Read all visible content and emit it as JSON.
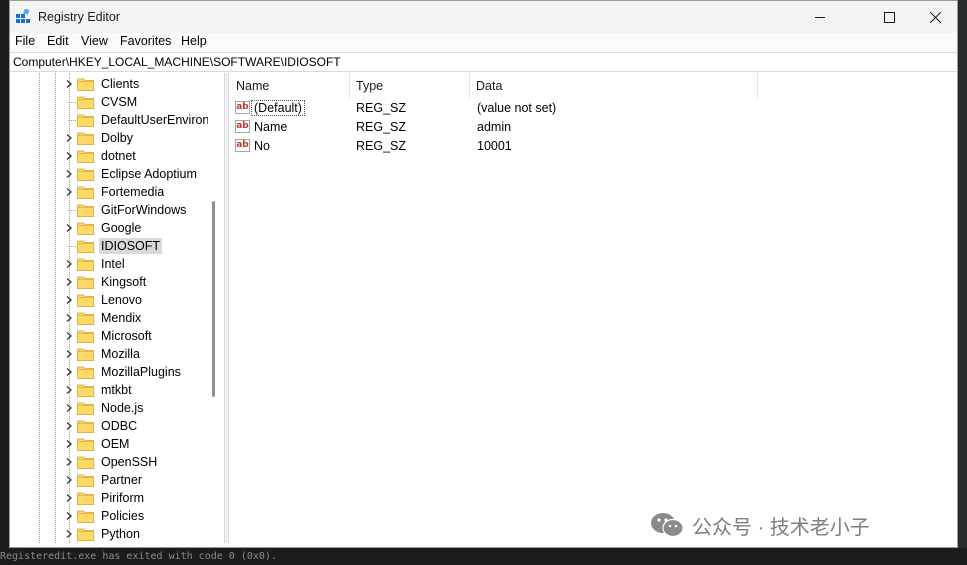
{
  "window": {
    "title": "Registry Editor"
  },
  "menu": [
    {
      "label": "File"
    },
    {
      "label": "Edit"
    },
    {
      "label": "View"
    },
    {
      "label": "Favorites"
    },
    {
      "label": "Help"
    }
  ],
  "address": "Computer\\HKEY_LOCAL_MACHINE\\SOFTWARE\\IDIOSOFT",
  "tree": {
    "items": [
      {
        "label": "Clients",
        "expandable": true
      },
      {
        "label": "CVSM",
        "expandable": false
      },
      {
        "label": "DefaultUserEnvironn",
        "expandable": false
      },
      {
        "label": "Dolby",
        "expandable": true
      },
      {
        "label": "dotnet",
        "expandable": true
      },
      {
        "label": "Eclipse Adoptium",
        "expandable": true
      },
      {
        "label": "Fortemedia",
        "expandable": true
      },
      {
        "label": "GitForWindows",
        "expandable": false
      },
      {
        "label": "Google",
        "expandable": true
      },
      {
        "label": "IDIOSOFT",
        "expandable": false,
        "selected": true
      },
      {
        "label": "Intel",
        "expandable": true
      },
      {
        "label": "Kingsoft",
        "expandable": true
      },
      {
        "label": "Lenovo",
        "expandable": true
      },
      {
        "label": "Mendix",
        "expandable": true
      },
      {
        "label": "Microsoft",
        "expandable": true
      },
      {
        "label": "Mozilla",
        "expandable": true
      },
      {
        "label": "MozillaPlugins",
        "expandable": true
      },
      {
        "label": "mtkbt",
        "expandable": true
      },
      {
        "label": "Node.js",
        "expandable": true
      },
      {
        "label": "ODBC",
        "expandable": true
      },
      {
        "label": "OEM",
        "expandable": true
      },
      {
        "label": "OpenSSH",
        "expandable": true
      },
      {
        "label": "Partner",
        "expandable": true
      },
      {
        "label": "Piriform",
        "expandable": true
      },
      {
        "label": "Policies",
        "expandable": true
      },
      {
        "label": "Python",
        "expandable": true
      }
    ]
  },
  "list": {
    "columns": [
      "Name",
      "Type",
      "Data"
    ],
    "rows": [
      {
        "name": "(Default)",
        "type": "REG_SZ",
        "data": "(value not set)",
        "icon": "ab"
      },
      {
        "name": "Name",
        "type": "REG_SZ",
        "data": "admin",
        "icon": "ab"
      },
      {
        "name": "No",
        "type": "REG_SZ",
        "data": "10001",
        "icon": "ab"
      }
    ]
  },
  "watermark": "公众号 · 技术老小子",
  "background_terminal": "Registeredit.exe  has exited with code 0 (0x0)."
}
